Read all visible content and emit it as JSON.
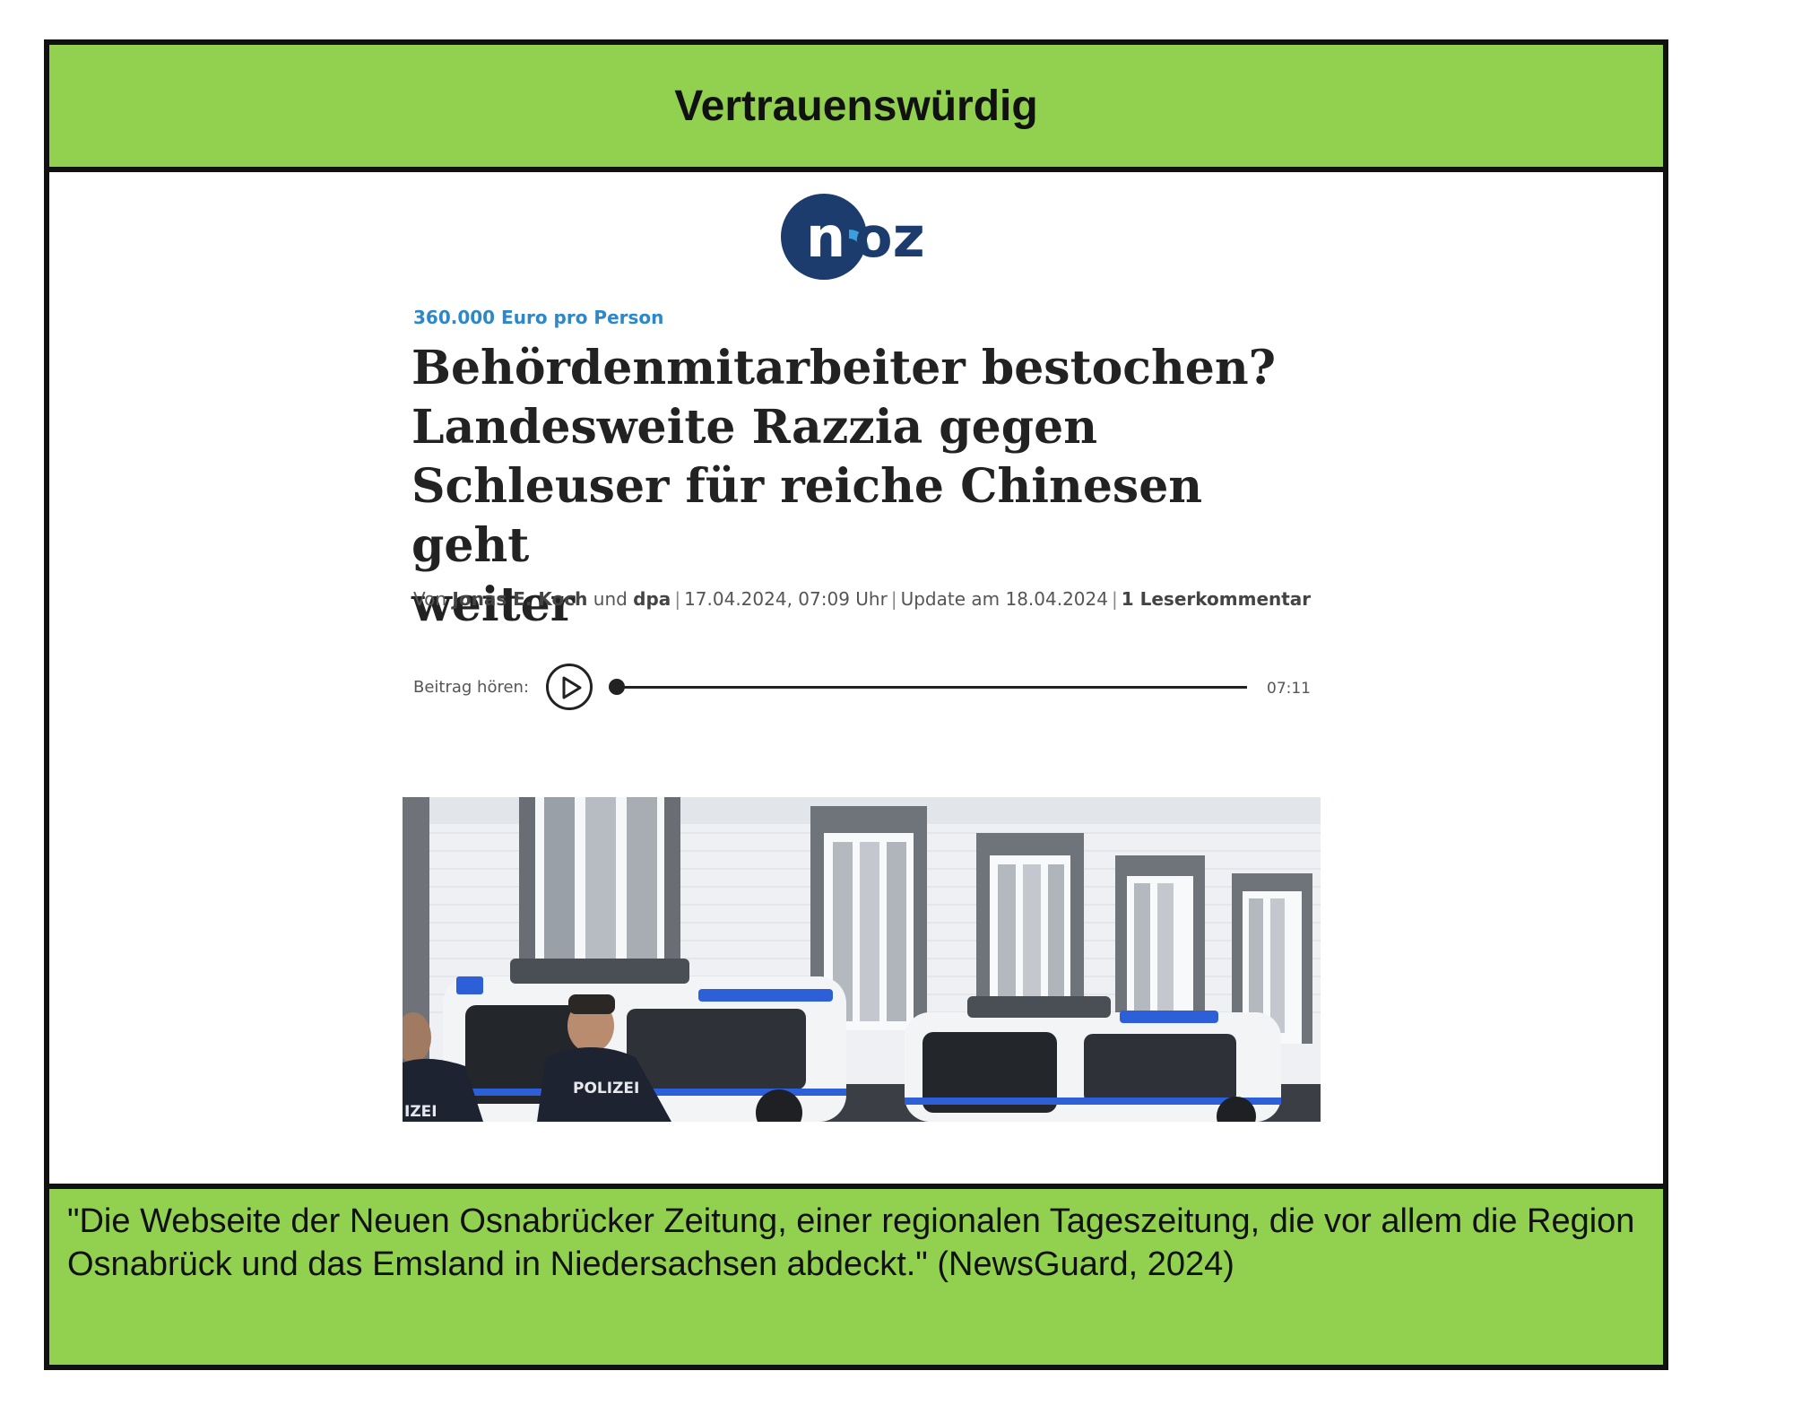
{
  "banner": {
    "label": "Vertrauenswürdig",
    "color": "#92d050"
  },
  "logo": {
    "text_n": "n",
    "text_oz": "oz",
    "name": "noz"
  },
  "article": {
    "kicker": "360.000 Euro pro Person",
    "headline_lines": [
      "Behördenmitarbeiter bestochen?",
      "Landesweite Razzia gegen",
      "Schleuser für reiche Chinesen geht",
      "weiter"
    ],
    "byline": {
      "prefix": "Von",
      "author": "Jonas E. Koch",
      "and": "und",
      "agency": "dpa",
      "date": "17.04.2024, 07:09 Uhr",
      "update": "Update am 18.04.2024",
      "comments": "1 Leserkommentar"
    },
    "audio": {
      "label": "Beitrag hören:",
      "duration": "07:11",
      "progress": 0
    },
    "photo": {
      "caption_hidden": "",
      "vehicle_text": "POLIZEI",
      "jacket_text": "POLIZEI",
      "jacket_text_partial": "IZEI"
    }
  },
  "footer": {
    "text": "\"Die Webseite der Neuen Osnabrücker Zeitung, einer regionalen Tageszeitung, die vor allem die Region Osnabrück und das Emsland in Niedersachsen abdeckt.\" (NewsGuard, 2024)"
  },
  "colors": {
    "accent_green": "#92d050",
    "kicker_blue": "#2e87c8",
    "logo_navy": "#1d3c6e",
    "logo_lightblue": "#3aa0dd"
  }
}
